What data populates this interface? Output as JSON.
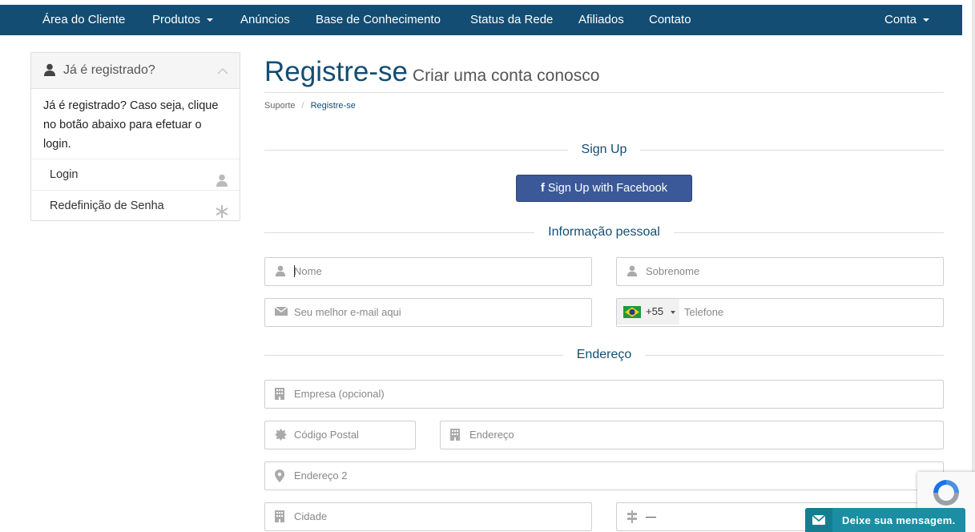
{
  "nav": {
    "items": [
      {
        "label": "Área do Cliente"
      },
      {
        "label": "Produtos"
      },
      {
        "label": "Anúncios"
      },
      {
        "label": "Base de Conhecimento"
      },
      {
        "label": "Status da Rede"
      },
      {
        "label": "Afiliados"
      },
      {
        "label": "Contato"
      }
    ],
    "account": "Conta"
  },
  "sidebar": {
    "title": "Já é registrado?",
    "body": "Já é registrado? Caso seja, clique no botão abaixo para efetuar o login.",
    "links": [
      {
        "label": "Login"
      },
      {
        "label": "Redefinição de Senha"
      }
    ]
  },
  "page": {
    "title": "Registre-se",
    "subtitle": "Criar uma conta conosco"
  },
  "breadcrumb": {
    "items": [
      "Suporte",
      "Registre-se"
    ]
  },
  "sections": {
    "signup": "Sign Up",
    "personal": "Informação pessoal",
    "address": "Endereço"
  },
  "facebook_button": {
    "icon": "f",
    "label": "Sign Up with Facebook"
  },
  "form": {
    "first_name": "Nome",
    "last_name": "Sobrenome",
    "email": "Seu melhor e-mail aqui",
    "phone_code": "+55",
    "phone": "Telefone",
    "company": "Empresa (opcional)",
    "postal_code": "Código Postal",
    "address1": "Endereço",
    "address2": "Endereço 2",
    "city": "Cidade",
    "state_value": "—"
  },
  "chat": {
    "label": "Deixe sua mensagem."
  },
  "colors": {
    "brand": "#134d73",
    "facebook": "#3b5998",
    "chat": "#1b8ea3"
  }
}
